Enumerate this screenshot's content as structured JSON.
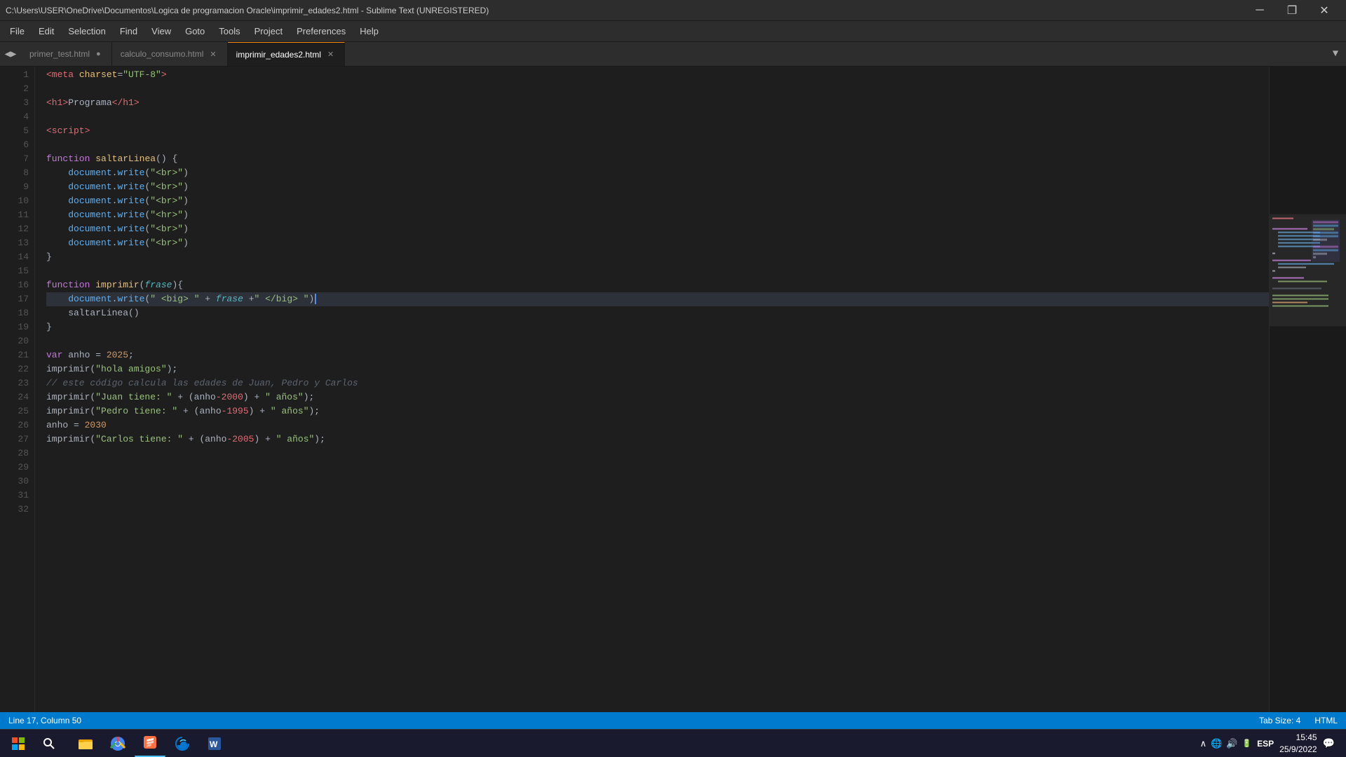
{
  "titlebar": {
    "title": "C:\\Users\\USER\\OneDrive\\Documentos\\Logica de programacion Oracle\\imprimir_edades2.html - Sublime Text (UNREGISTERED)",
    "minimize": "─",
    "maximize": "□",
    "close": "✕"
  },
  "menubar": {
    "items": [
      "File",
      "Edit",
      "Selection",
      "Find",
      "View",
      "Goto",
      "Tools",
      "Project",
      "Preferences",
      "Help"
    ]
  },
  "tabs": [
    {
      "label": "primer_test.html",
      "active": false,
      "dot": true
    },
    {
      "label": "calculo_consumo.html",
      "active": false,
      "dot": false
    },
    {
      "label": "imprimir_edades2.html",
      "active": true,
      "dot": false
    }
  ],
  "statusbar": {
    "position": "Line 17, Column 50",
    "tab_size": "Tab Size: 4",
    "language": "HTML"
  },
  "code_lines": [
    {
      "num": 1,
      "content": ""
    },
    {
      "num": 2,
      "content": ""
    },
    {
      "num": 3,
      "content": ""
    },
    {
      "num": 4,
      "content": ""
    },
    {
      "num": 5,
      "content": ""
    },
    {
      "num": 6,
      "content": ""
    },
    {
      "num": 7,
      "content": ""
    },
    {
      "num": 8,
      "content": ""
    },
    {
      "num": 9,
      "content": ""
    },
    {
      "num": 10,
      "content": ""
    },
    {
      "num": 11,
      "content": ""
    },
    {
      "num": 12,
      "content": ""
    },
    {
      "num": 13,
      "content": ""
    },
    {
      "num": 14,
      "content": ""
    },
    {
      "num": 15,
      "content": ""
    },
    {
      "num": 16,
      "content": ""
    },
    {
      "num": 17,
      "content": ""
    },
    {
      "num": 18,
      "content": ""
    },
    {
      "num": 19,
      "content": ""
    },
    {
      "num": 20,
      "content": ""
    },
    {
      "num": 21,
      "content": ""
    },
    {
      "num": 22,
      "content": ""
    },
    {
      "num": 23,
      "content": ""
    },
    {
      "num": 24,
      "content": ""
    },
    {
      "num": 25,
      "content": ""
    },
    {
      "num": 26,
      "content": ""
    },
    {
      "num": 27,
      "content": ""
    },
    {
      "num": 28,
      "content": ""
    },
    {
      "num": 29,
      "content": ""
    },
    {
      "num": 30,
      "content": ""
    },
    {
      "num": 31,
      "content": ""
    },
    {
      "num": 32,
      "content": ""
    }
  ],
  "taskbar": {
    "time": "15:45",
    "date": "25/9/2022",
    "language": "ESP",
    "start_icon": "⊞"
  }
}
